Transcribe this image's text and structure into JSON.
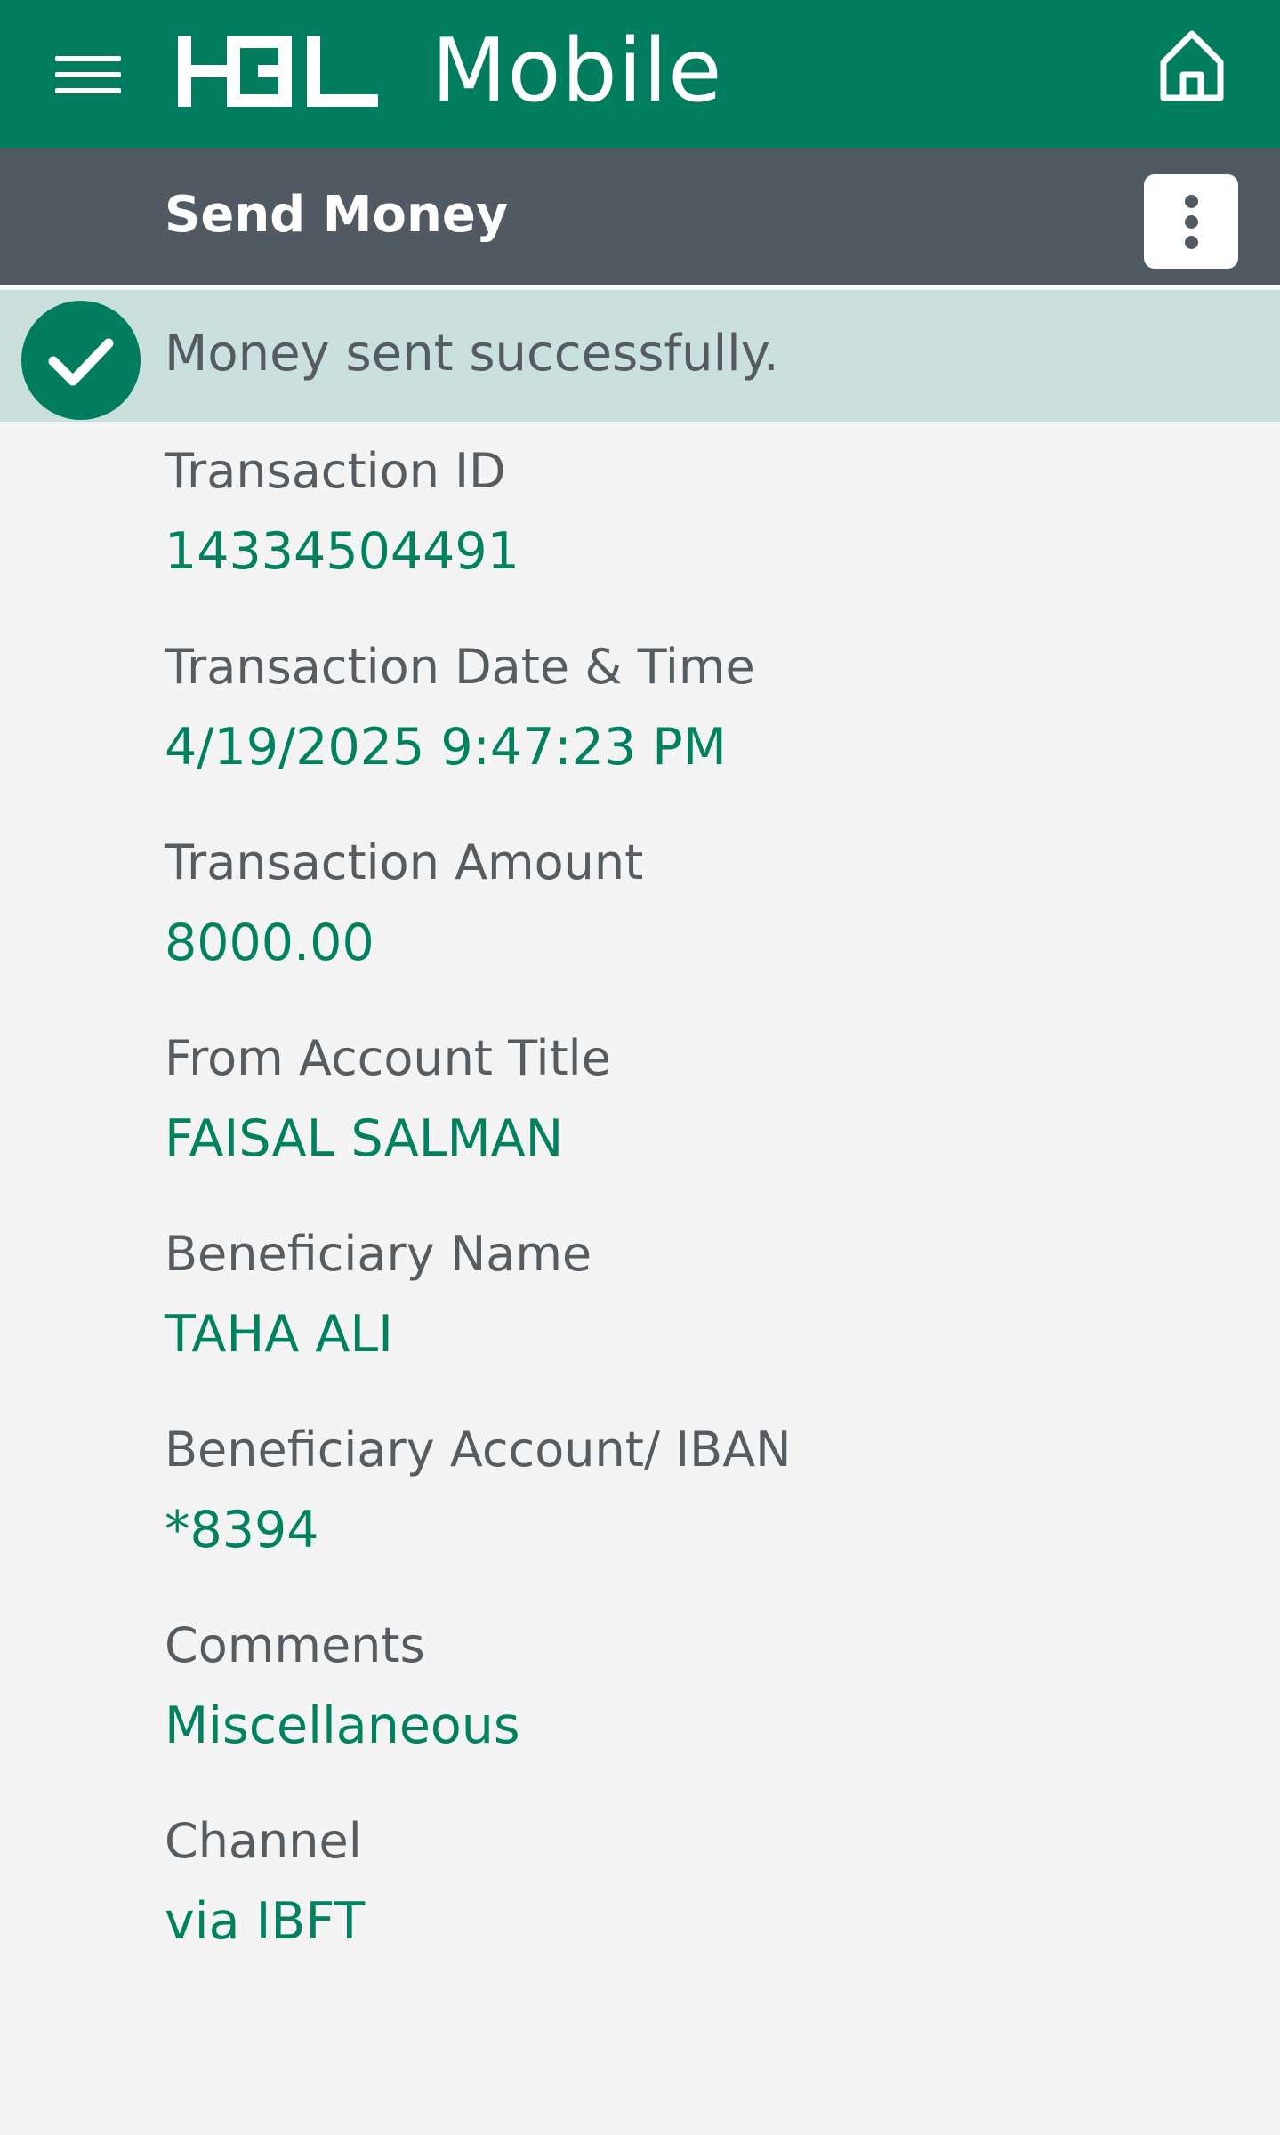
{
  "header": {
    "brand_logo_text": "HBL",
    "brand_text": "Mobile",
    "bg_color": "#007c5e",
    "menu_icon": "hamburger-menu-icon",
    "home_icon": "home-icon"
  },
  "subheader": {
    "title": "Send Money",
    "bg_color": "#515a63",
    "more_icon": "more-vertical-icon"
  },
  "banner": {
    "message": "Money sent successfully.",
    "icon": "checkmark-circle-icon",
    "bg_color": "#c9e0dc"
  },
  "details": [
    {
      "label": "Transaction ID",
      "value": "14334504491"
    },
    {
      "label": "Transaction Date & Time",
      "value": "4/19/2025 9:47:23 PM"
    },
    {
      "label": "Transaction Amount",
      "value": "8000.00"
    },
    {
      "label": "From Account Title",
      "value": "FAISAL SALMAN"
    },
    {
      "label": "Beneficiary Name",
      "value": "TAHA ALI"
    },
    {
      "label": "Beneficiary Account/ IBAN",
      "value": "*8394"
    },
    {
      "label": "Comments",
      "value": "Miscellaneous"
    },
    {
      "label": "Channel",
      "value": "via IBFT"
    }
  ],
  "colors": {
    "accent": "#007c5e",
    "value_text": "#00825f",
    "label_text": "#575c61"
  }
}
